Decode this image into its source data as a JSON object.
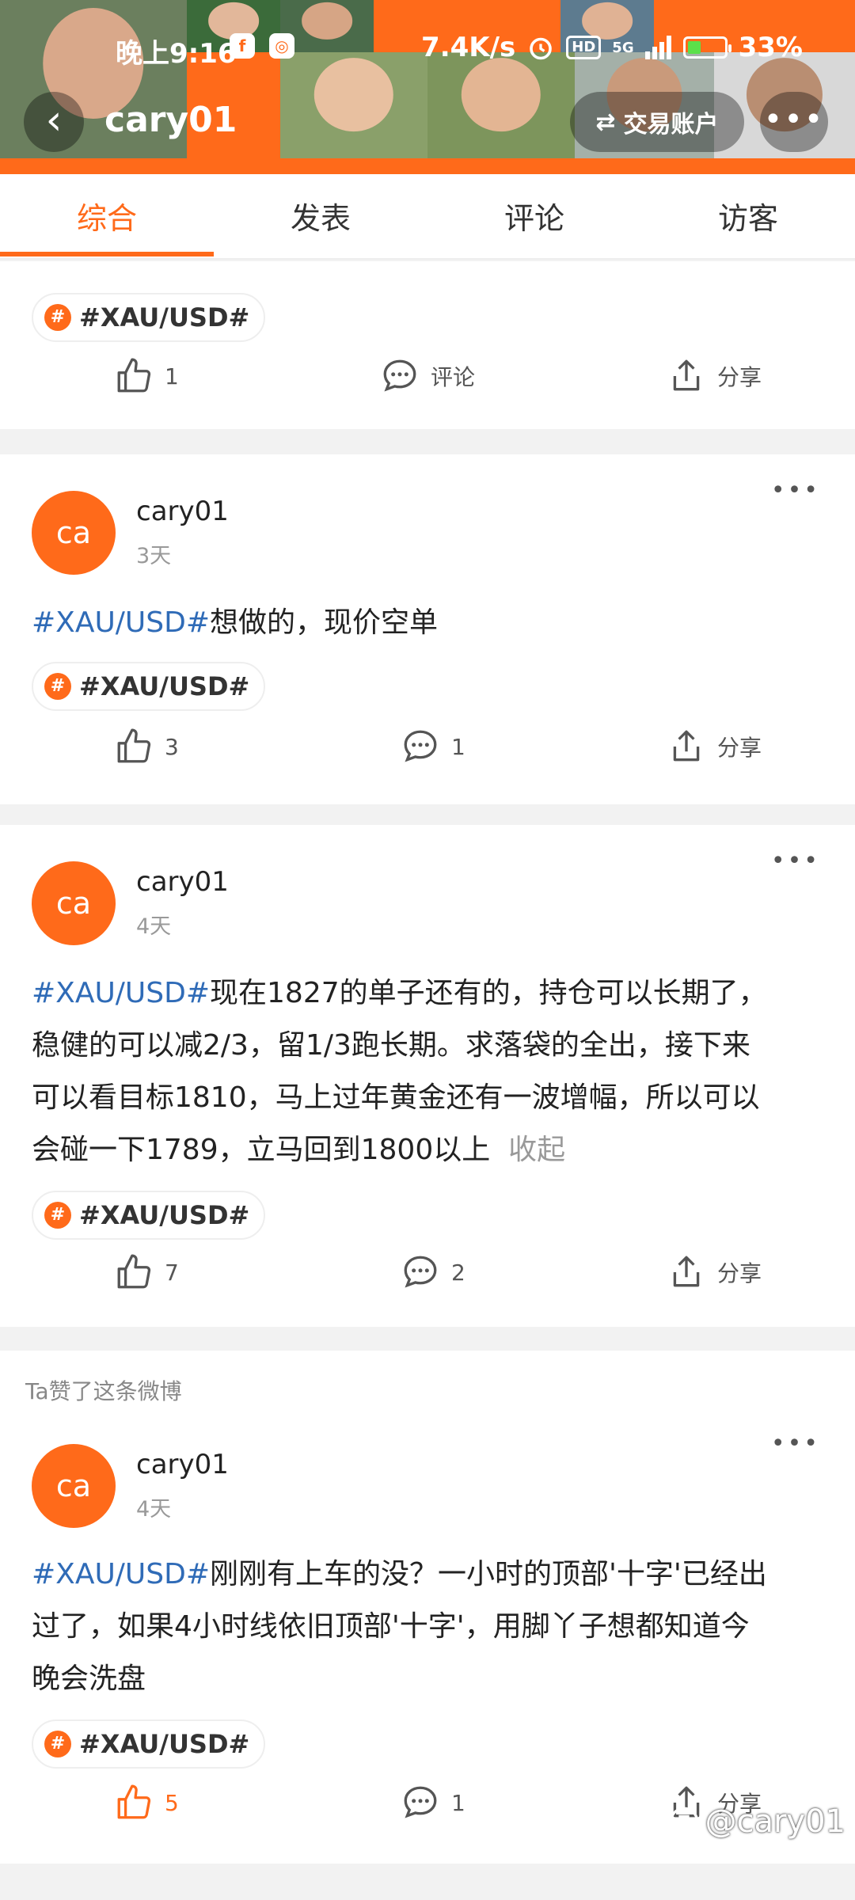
{
  "status_bar": {
    "time": "晚上9:16",
    "net_speed": "7.4K/s",
    "hd": "HD",
    "signal": "5G",
    "battery": "33%",
    "icons": [
      "notification-app-icon",
      "notification-app-icon",
      "alarm-icon",
      "signal-icon",
      "battery-icon"
    ]
  },
  "nav": {
    "back_icon": "‹",
    "title": "cary01",
    "trade_label": "交易账户",
    "trade_icon": "⇄",
    "more_icon": "•••"
  },
  "tabs": [
    {
      "label": "综合",
      "active": true
    },
    {
      "label": "发表",
      "active": false
    },
    {
      "label": "评论",
      "active": false
    },
    {
      "label": "访客",
      "active": false
    }
  ],
  "colors": {
    "accent": "#ff6a1a",
    "topic": "#2f6bb7",
    "muted": "#999999"
  },
  "posts": [
    {
      "partial": true,
      "tag": "#XAU/USD#",
      "likes": "1",
      "comments": "评论",
      "share": "分享"
    },
    {
      "avatar": "ca",
      "user": "cary01",
      "time": "3天",
      "topic": "#XAU/USD#",
      "text": "想做的，现价空单",
      "tag": "#XAU/USD#",
      "likes": "3",
      "comments": "1",
      "share": "分享"
    },
    {
      "avatar": "ca",
      "user": "cary01",
      "time": "4天",
      "topic": "#XAU/USD#",
      "line1": "现在1827的单子还有的，持仓可以长期了，",
      "line2": "稳健的可以减2/3，留1/3跑长期。求落袋的全出，接下来",
      "line3": "可以看目标1810，马上过年黄金还有一波增幅，所以可以",
      "line4": "会碰一下1789，立马回到1800以上",
      "fold": "收起",
      "tag": "#XAU/USD#",
      "likes": "7",
      "comments": "2",
      "share": "分享"
    },
    {
      "liked_note": "Ta赞了这条微博",
      "avatar": "ca",
      "user": "cary01",
      "time": "4天",
      "topic": "#XAU/USD#",
      "line1": "刚刚有上车的没？一小时的顶部'十字'已经出",
      "line2": "过了，如果4小时线依旧顶部'十字'，用脚丫子想都知道今",
      "line3": "晚会洗盘",
      "tag": "#XAU/USD#",
      "likes": "5",
      "comments": "1",
      "share": "分享"
    }
  ],
  "watermark": "@cary01"
}
